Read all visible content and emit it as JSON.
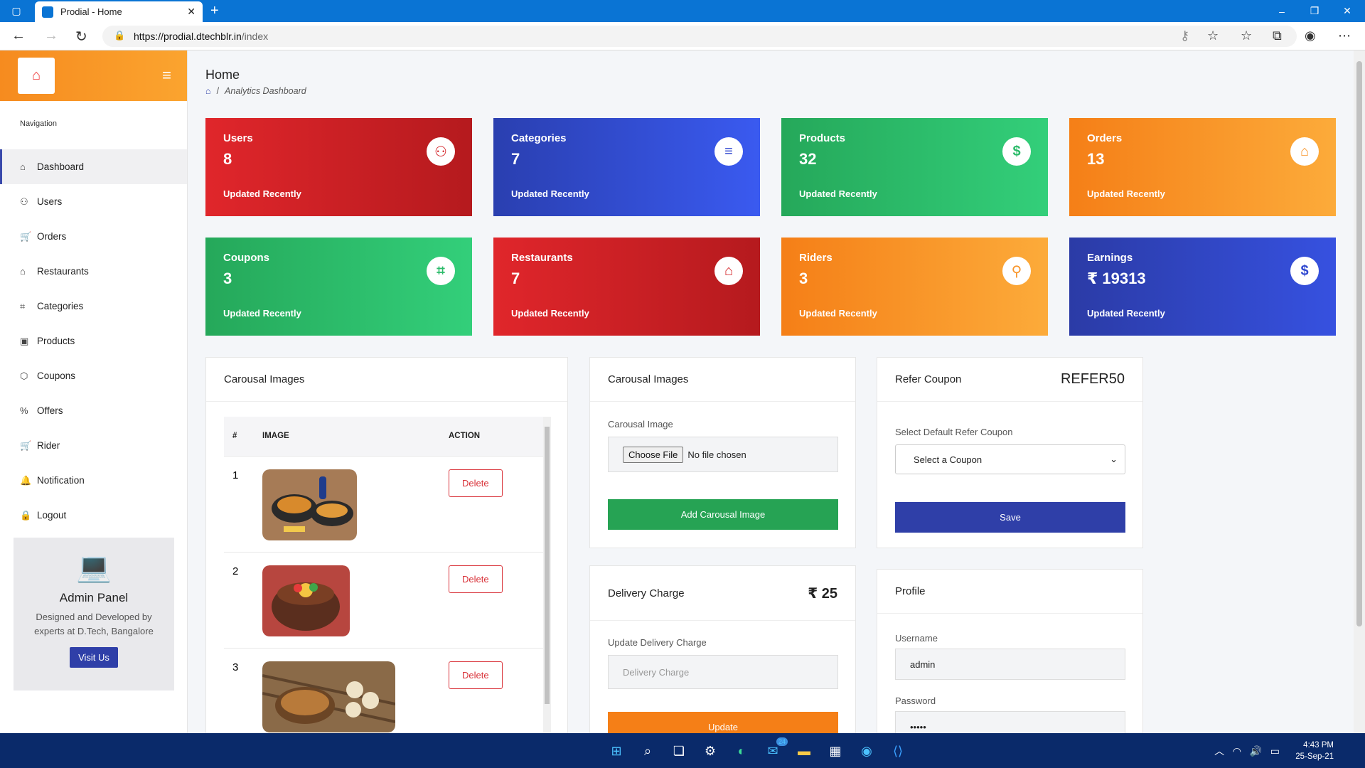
{
  "browser": {
    "tab_title": "Prodial - Home",
    "url_host": "https://prodial.dtechblr.in",
    "url_path": "/index"
  },
  "sidebar": {
    "nav_heading": "Navigation",
    "items": [
      {
        "label": "Dashboard",
        "icon": "home-icon"
      },
      {
        "label": "Users",
        "icon": "user-icon"
      },
      {
        "label": "Orders",
        "icon": "cart-icon"
      },
      {
        "label": "Restaurants",
        "icon": "home-icon"
      },
      {
        "label": "Categories",
        "icon": "tag-icon"
      },
      {
        "label": "Products",
        "icon": "box-icon"
      },
      {
        "label": "Coupons",
        "icon": "package-icon"
      },
      {
        "label": "Offers",
        "icon": "percent-icon"
      },
      {
        "label": "Rider",
        "icon": "cart-icon"
      },
      {
        "label": "Notification",
        "icon": "bell-icon"
      },
      {
        "label": "Logout",
        "icon": "lock-icon"
      }
    ],
    "admin_title": "Admin Panel",
    "admin_desc": "Designed and Developed by experts at D.Tech, Bangalore",
    "visit_label": "Visit Us"
  },
  "header": {
    "title": "Home",
    "breadcrumb": "Analytics Dashboard"
  },
  "stats": [
    {
      "label": "Users",
      "value": "8",
      "updated": "Updated Recently",
      "icon": "user-icon",
      "color": "#d32024"
    },
    {
      "label": "Categories",
      "value": "7",
      "updated": "Updated Recently",
      "icon": "database-icon",
      "color": "#3149d0"
    },
    {
      "label": "Products",
      "value": "32",
      "updated": "Updated Recently",
      "icon": "dollar-icon",
      "color": "#2cbb6a"
    },
    {
      "label": "Orders",
      "value": "13",
      "updated": "Updated Recently",
      "icon": "basket-icon",
      "color": "#f8952a"
    },
    {
      "label": "Coupons",
      "value": "3",
      "updated": "Updated Recently",
      "icon": "tags-icon",
      "color": "#2cbb6a"
    },
    {
      "label": "Restaurants",
      "value": "7",
      "updated": "Updated Recently",
      "icon": "home-icon",
      "color": "#d32024"
    },
    {
      "label": "Riders",
      "value": "3",
      "updated": "Updated Recently",
      "icon": "motorcycle-icon",
      "color": "#f8952a"
    },
    {
      "label": "Earnings",
      "value": "₹ 19313",
      "updated": "Updated Recently",
      "icon": "dollar-icon",
      "color": "#3149d0"
    }
  ],
  "carousel_table": {
    "title": "Carousal Images",
    "headers": [
      "#",
      "IMAGE",
      "ACTION"
    ],
    "rows": [
      {
        "num": "1",
        "action": "Delete"
      },
      {
        "num": "2",
        "action": "Delete"
      },
      {
        "num": "3",
        "action": "Delete"
      }
    ]
  },
  "carousel_form": {
    "title": "Carousal Images",
    "field_label": "Carousal Image",
    "choose_label": "Choose File",
    "no_file": "No file chosen",
    "button_label": "Add Carousal Image"
  },
  "delivery": {
    "title": "Delivery Charge",
    "amount": "₹ 25",
    "field_label": "Update Delivery Charge",
    "placeholder": "Delivery Charge",
    "button_label": "Update"
  },
  "refer": {
    "title": "Refer Coupon",
    "code": "REFER50",
    "field_label": "Select Default Refer Coupon",
    "select_value": "Select a Coupon",
    "button_label": "Save"
  },
  "profile": {
    "title": "Profile",
    "username_label": "Username",
    "username_value": "admin",
    "password_label": "Password",
    "password_value": "•••••"
  },
  "taskbar": {
    "time": "4:43 PM",
    "date": "25-Sep-21",
    "mail_badge": "24"
  }
}
